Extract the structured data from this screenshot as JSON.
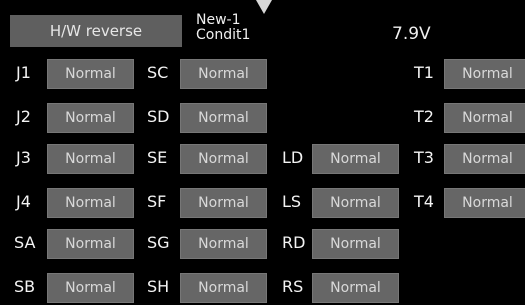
{
  "header": {
    "title": "H/W reverse",
    "model_line1": "New-1",
    "model_line2": "Condit1",
    "voltage": "7.9V"
  },
  "icons": {
    "top_indicator": "down-triangle-icon"
  },
  "channels": [
    {
      "id": "J1",
      "label": "J1",
      "value": "Normal"
    },
    {
      "id": "J2",
      "label": "J2",
      "value": "Normal"
    },
    {
      "id": "J3",
      "label": "J3",
      "value": "Normal"
    },
    {
      "id": "J4",
      "label": "J4",
      "value": "Normal"
    },
    {
      "id": "SA",
      "label": "SA",
      "value": "Normal"
    },
    {
      "id": "SB",
      "label": "SB",
      "value": "Normal"
    },
    {
      "id": "SC",
      "label": "SC",
      "value": "Normal"
    },
    {
      "id": "SD",
      "label": "SD",
      "value": "Normal"
    },
    {
      "id": "SE",
      "label": "SE",
      "value": "Normal"
    },
    {
      "id": "SF",
      "label": "SF",
      "value": "Normal"
    },
    {
      "id": "SG",
      "label": "SG",
      "value": "Normal"
    },
    {
      "id": "SH",
      "label": "SH",
      "value": "Normal"
    },
    {
      "id": "LD",
      "label": "LD",
      "value": "Normal"
    },
    {
      "id": "LS",
      "label": "LS",
      "value": "Normal"
    },
    {
      "id": "RD",
      "label": "RD",
      "value": "Normal"
    },
    {
      "id": "RS",
      "label": "RS",
      "value": "Normal"
    },
    {
      "id": "T1",
      "label": "T1",
      "value": "Normal"
    },
    {
      "id": "T2",
      "label": "T2",
      "value": "Normal"
    },
    {
      "id": "T3",
      "label": "T3",
      "value": "Normal"
    },
    {
      "id": "T4",
      "label": "T4",
      "value": "Normal"
    }
  ]
}
